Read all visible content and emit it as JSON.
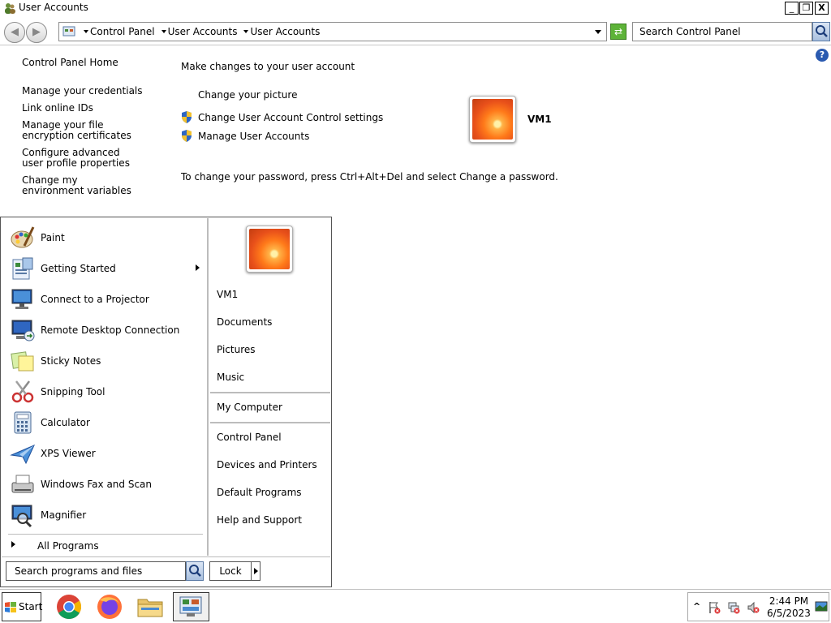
{
  "window": {
    "title": "User Accounts",
    "buttons": {
      "minimize": "_",
      "restore": "❐",
      "close": "X"
    }
  },
  "address": {
    "crumbs": [
      "Control Panel",
      "User Accounts",
      "User Accounts"
    ],
    "search_placeholder": "Search Control Panel"
  },
  "nav": {
    "home": "Control Panel Home",
    "links": [
      "Manage your credentials",
      "Link online IDs",
      "Manage your file encryption certificates",
      "Configure advanced user profile properties",
      "Change my environment variables"
    ]
  },
  "main": {
    "heading": "Make changes to your user account",
    "tasks": {
      "change_picture": "Change your picture",
      "uac": "Change User Account Control settings",
      "manage": "Manage User Accounts"
    },
    "username": "VM1",
    "password_note": "To change your password, press Ctrl+Alt+Del and select Change a password."
  },
  "start_menu": {
    "programs": [
      {
        "label": "Paint",
        "icon": "paint-icon"
      },
      {
        "label": "Getting Started",
        "icon": "getting-started-icon"
      },
      {
        "label": "Connect to a Projector",
        "icon": "projector-icon"
      },
      {
        "label": "Remote Desktop Connection",
        "icon": "remote-desktop-icon"
      },
      {
        "label": "Sticky Notes",
        "icon": "sticky-notes-icon"
      },
      {
        "label": "Snipping Tool",
        "icon": "snipping-tool-icon"
      },
      {
        "label": "Calculator",
        "icon": "calculator-icon"
      },
      {
        "label": "XPS Viewer",
        "icon": "xps-viewer-icon"
      },
      {
        "label": "Windows Fax and Scan",
        "icon": "fax-scan-icon"
      },
      {
        "label": "Magnifier",
        "icon": "magnifier-icon"
      }
    ],
    "all_programs": "All Programs",
    "right_items": {
      "user": "VM1",
      "documents": "Documents",
      "pictures": "Pictures",
      "music": "Music",
      "computer": "My Computer",
      "control_panel": "Control Panel",
      "devices": "Devices and Printers",
      "default_programs": "Default Programs",
      "help": "Help and Support"
    },
    "search_placeholder": "Search programs and files",
    "lock": "Lock"
  },
  "taskbar": {
    "start": "Start",
    "pinned": [
      "chrome-icon",
      "firefox-icon",
      "file-explorer-icon",
      "control-panel-icon"
    ],
    "time": "2:44 PM",
    "date": "6/5/2023",
    "tray_expander": "^"
  }
}
